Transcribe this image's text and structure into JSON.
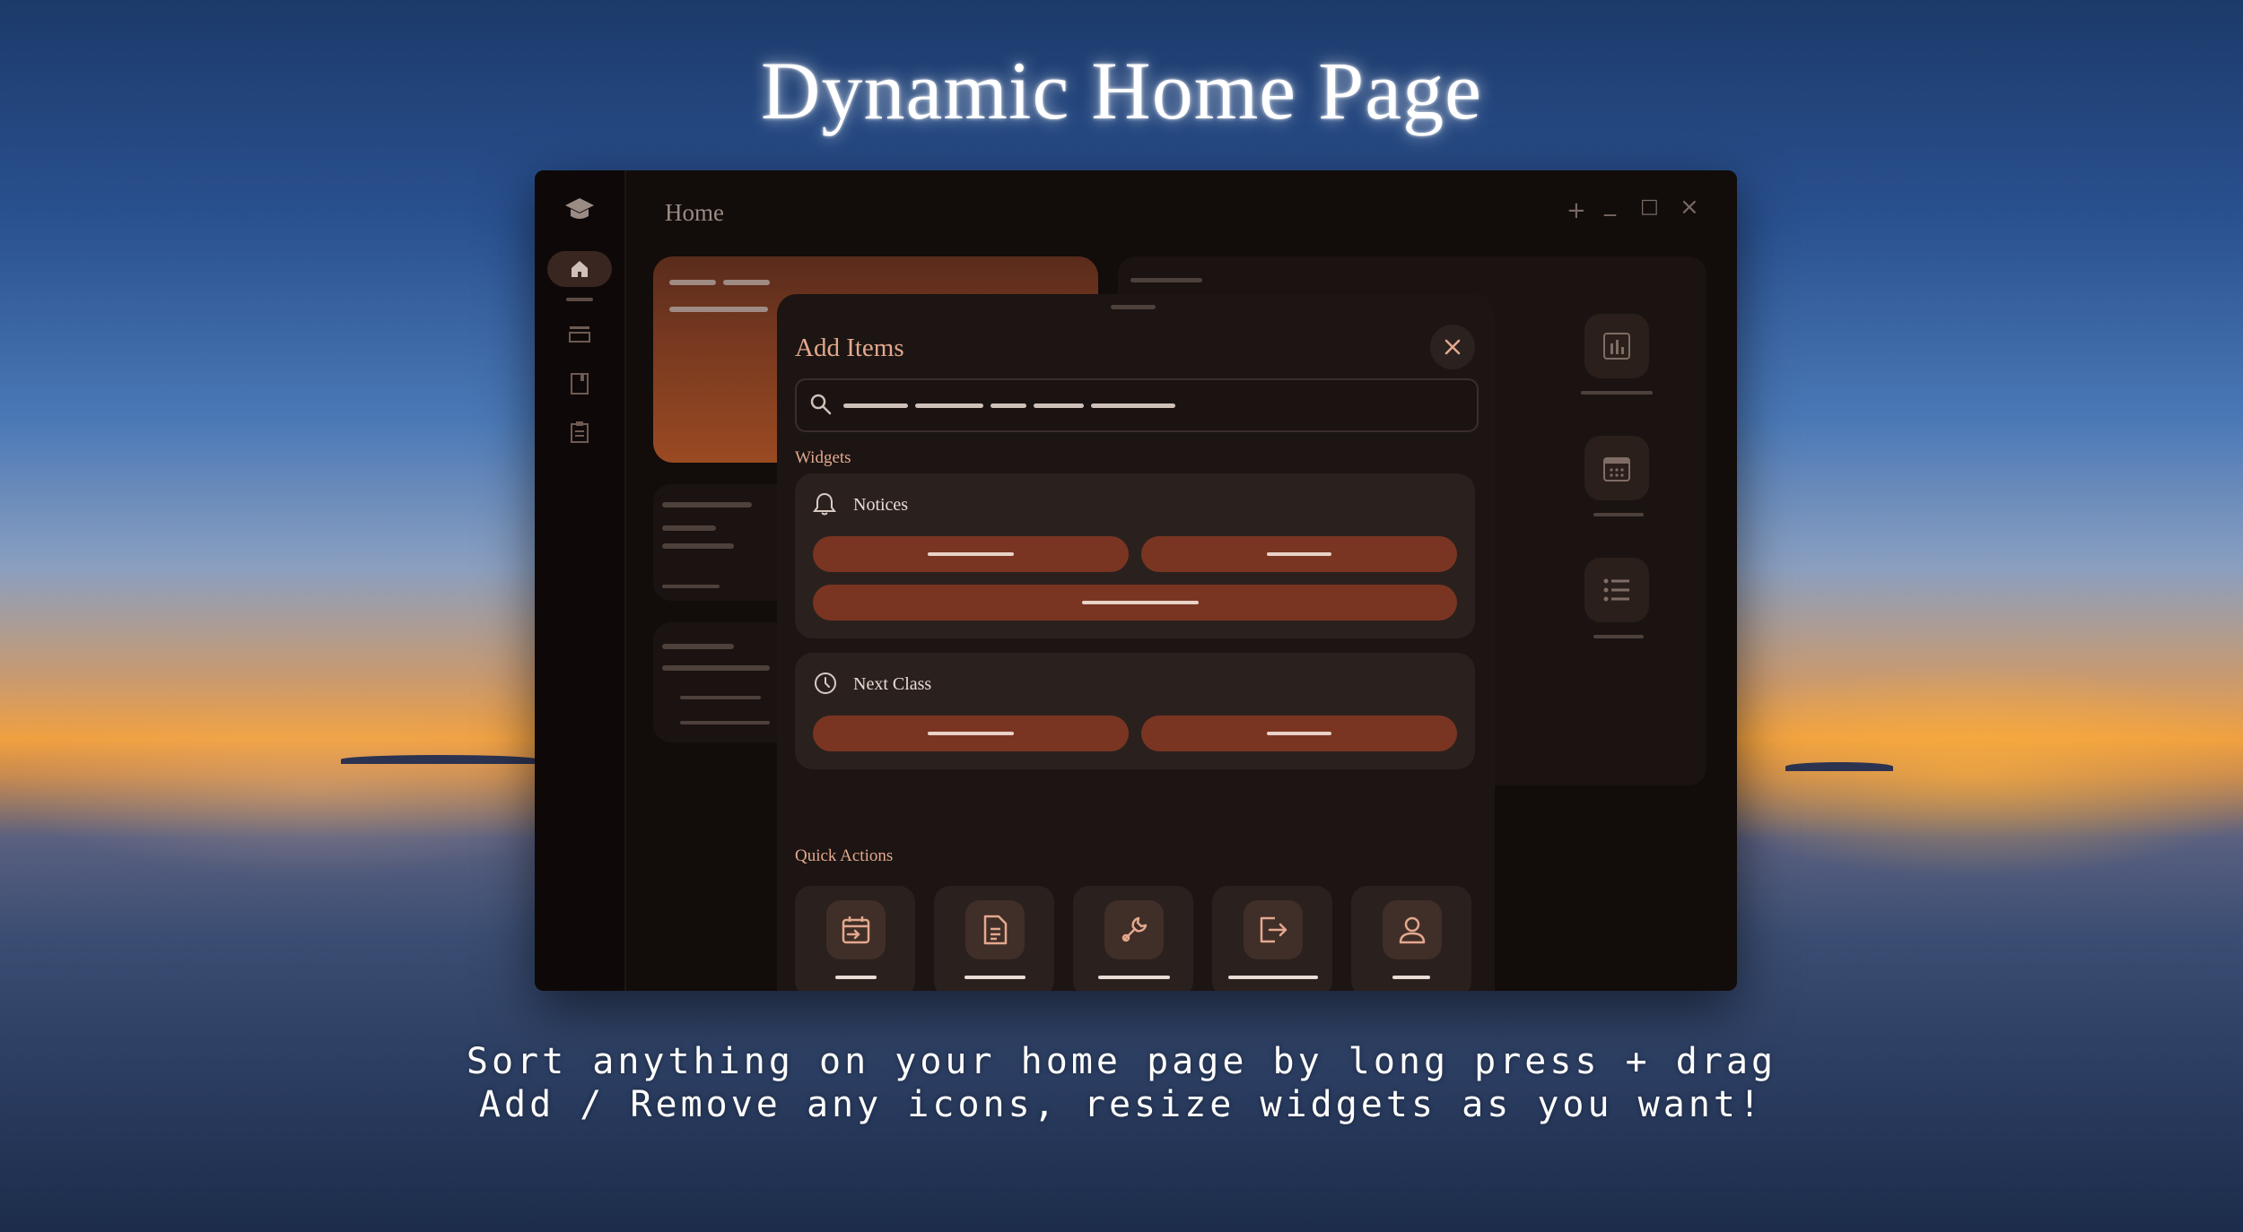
{
  "headline": "Dynamic Home Page",
  "caption": {
    "line1": "Sort anything on your home page by long press + drag",
    "line2": "Add / Remove any icons, resize widgets as you want!"
  },
  "window": {
    "title": "Home",
    "controls": {
      "add": "+",
      "minimize": "_",
      "maximize": "□",
      "close": "×"
    }
  },
  "rail": {
    "items": [
      {
        "icon": "graduation-cap-icon"
      },
      {
        "icon": "home-icon",
        "active": true
      },
      {
        "icon": "list-icon"
      },
      {
        "icon": "book-icon"
      },
      {
        "icon": "clipboard-icon"
      }
    ]
  },
  "modal": {
    "title": "Add Items",
    "widgets_label": "Widgets",
    "widgets": [
      {
        "title": "Notices",
        "icon": "bell-icon"
      },
      {
        "title": "Next Class",
        "icon": "clock-icon"
      }
    ],
    "quick_actions_label": "Quick Actions",
    "quick_actions": [
      {
        "icon": "calendar-import-icon"
      },
      {
        "icon": "document-icon"
      },
      {
        "icon": "wrench-icon"
      },
      {
        "icon": "logout-icon"
      },
      {
        "icon": "person-icon"
      }
    ]
  },
  "colors": {
    "accent": "#e3a88d",
    "pill": "#7a3522",
    "window_bg": "#120c0a"
  }
}
